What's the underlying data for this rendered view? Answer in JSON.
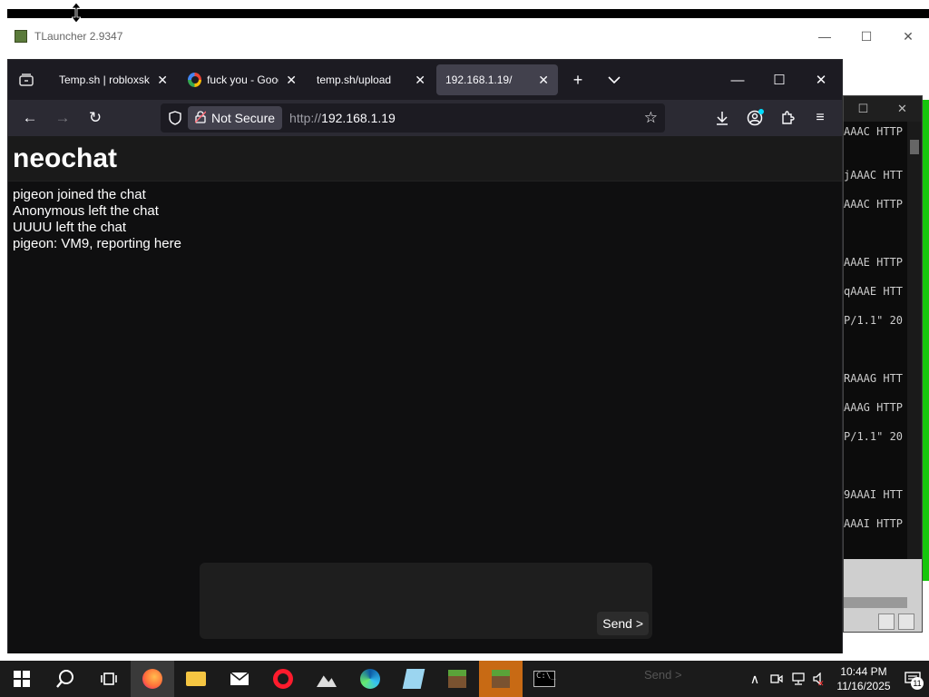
{
  "background_window": {
    "title": "TLauncher 2.9347",
    "minimize": "—",
    "maximize": "☐",
    "close": "✕"
  },
  "terminal": {
    "lines": [
      "AAAC HTTP",
      "jAAAC HTT",
      "AAAC HTTP",
      "AAAE HTTP",
      "qAAAE HTT",
      "P/1.1\" 20",
      "RAAAG HTT",
      "AAAG HTTP",
      "P/1.1\" 20",
      "9AAAI HTT",
      "AAAI HTTP"
    ]
  },
  "browser": {
    "tabs": [
      {
        "label": "Temp.sh | robloxskyli",
        "active": false,
        "icon": null
      },
      {
        "label": "fuck you - Googl",
        "active": false,
        "icon": "google-icon"
      },
      {
        "label": "temp.sh/upload",
        "active": false,
        "icon": null
      },
      {
        "label": "192.168.1.19/",
        "active": true,
        "icon": null
      }
    ],
    "new_tab": "+",
    "list_all_tabs": "⌄",
    "window_controls": {
      "minimize": "—",
      "maximize": "☐",
      "close": "✕"
    },
    "nav": {
      "back": "←",
      "forward": "→",
      "reload": "↻",
      "security_label": "Not Secure",
      "url_protocol": "http://",
      "url_host": "192.168.1.19",
      "bookmark": "☆"
    },
    "toolbar": {
      "downloads": "⤓",
      "account": "◉",
      "extensions": "⧉",
      "menu": "≡"
    }
  },
  "page": {
    "title": "neochat",
    "messages": [
      "pigeon joined the chat",
      "Anonymous left the chat",
      "UUUU left the chat",
      "pigeon: VM9, reporting here"
    ],
    "composer_placeholder": "",
    "send_label": "Send >"
  },
  "taskbar": {
    "ghost_send": "Send >",
    "clock_time": "10:44 PM",
    "clock_date": "11/16/2025",
    "notification_count": "11",
    "tray_chevron": "∧"
  }
}
